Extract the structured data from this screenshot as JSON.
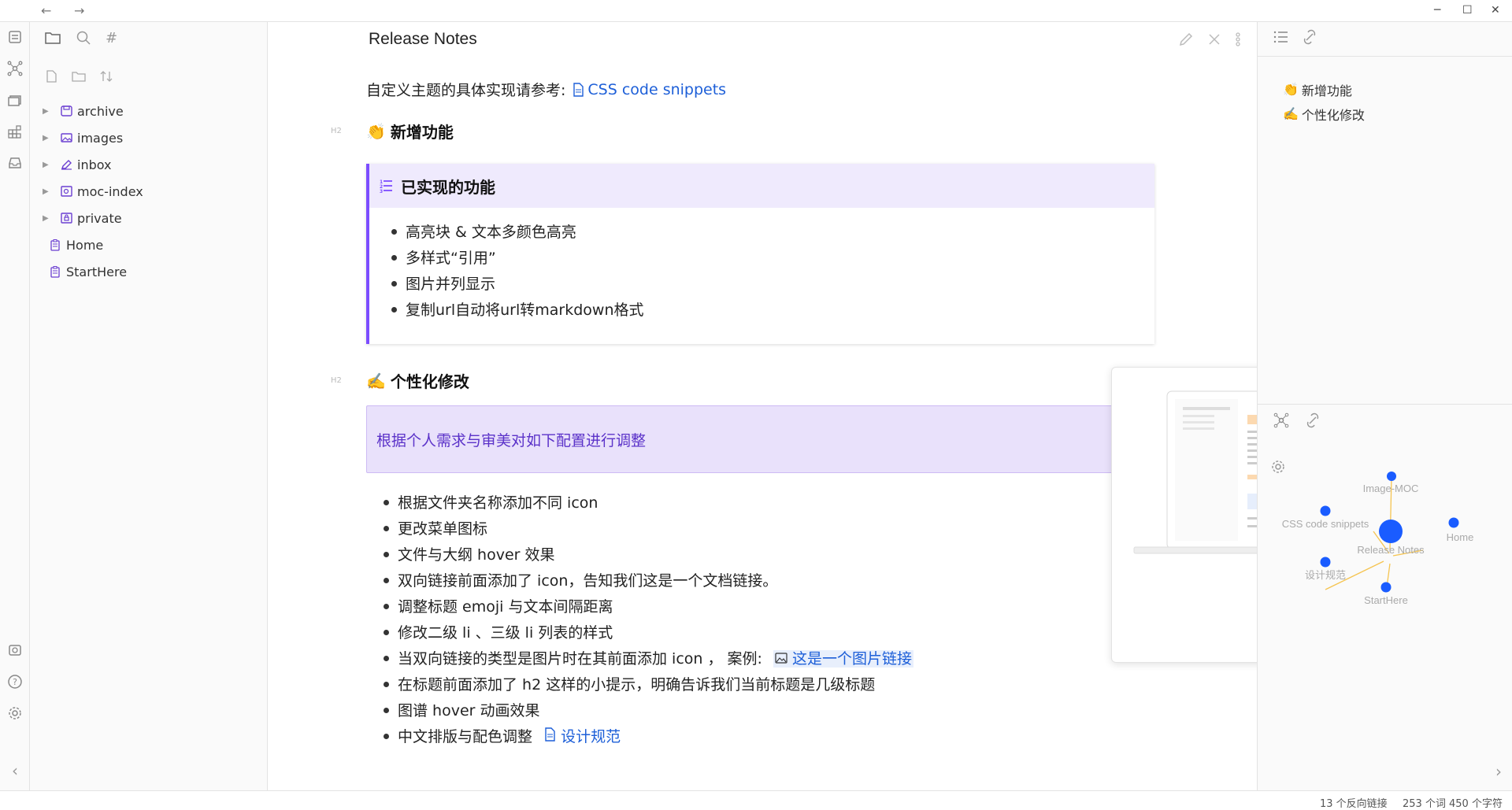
{
  "titlebar": {
    "back": "←",
    "forward": "→",
    "minimize": "─",
    "maximize": "☐",
    "close": "✕"
  },
  "sidebar": {
    "folders": [
      {
        "label": "archive",
        "icon": "archive-folder-icon",
        "color": "#6b3fd1"
      },
      {
        "label": "images",
        "icon": "images-folder-icon",
        "color": "#6b3fd1"
      },
      {
        "label": "inbox",
        "icon": "inbox-folder-icon",
        "color": "#6b3fd1"
      },
      {
        "label": "moc-index",
        "icon": "moc-index-folder-icon",
        "color": "#6b3fd1"
      },
      {
        "label": "private",
        "icon": "private-folder-icon",
        "color": "#6b3fd1"
      }
    ],
    "files": [
      {
        "label": "Home",
        "icon": "note-icon"
      },
      {
        "label": "StartHere",
        "icon": "note-icon"
      }
    ]
  },
  "editor": {
    "title": "Release Notes",
    "intro_text": "自定义主题的具体实现请参考:",
    "intro_link": "CSS code snippets",
    "h2_tag": "H2",
    "section1": {
      "emoji": "👏",
      "title": "新增功能"
    },
    "callout1": {
      "title": "已实现的功能",
      "items": [
        "高亮块 & 文本多颜色高亮",
        "多样式“引用”",
        "图片并列显示",
        "复制url自动将url转markdown格式"
      ]
    },
    "section2": {
      "emoji": "✍️",
      "title": "个性化修改"
    },
    "callout2_text": "根据个人需求与审美对如下配置进行调整",
    "list": [
      {
        "text": "根据文件夹名称添加不同 icon"
      },
      {
        "text": "更改菜单图标"
      },
      {
        "text": "文件与大纲 hover 效果"
      },
      {
        "text": "双向链接前面添加了 icon，告知我们这是一个文档链接。"
      },
      {
        "text": "调整标题 emoji 与文本间隔距离"
      },
      {
        "text": "修改二级 li 、三级 li 列表的样式"
      },
      {
        "text": "当双向链接的类型是图片时在其前面添加 icon ， 案例:",
        "link": "这是一个图片链接"
      },
      {
        "text": "在标题前面添加了 h2 这样的小提示，明确告诉我们当前标题是几级标题"
      },
      {
        "text": "图谱 hover 动画效果"
      },
      {
        "text": "中文排版与配色调整",
        "link": "设计规范"
      }
    ]
  },
  "outline": {
    "items": [
      {
        "emoji": "👏",
        "label": "新增功能"
      },
      {
        "emoji": "✍️",
        "label": "个性化修改"
      }
    ]
  },
  "graph": {
    "nodes": [
      {
        "label": "Image-MOC"
      },
      {
        "label": "CSS code snippets"
      },
      {
        "label": "Release Notes"
      },
      {
        "label": "Home"
      },
      {
        "label": "设计规范"
      },
      {
        "label": "StartHere"
      }
    ],
    "node_color": "#1a5cff",
    "edge_color": "#f5c451"
  },
  "status": {
    "backlinks": "13 个反向链接",
    "words": "253 个词",
    "chars": "450 个字符"
  }
}
